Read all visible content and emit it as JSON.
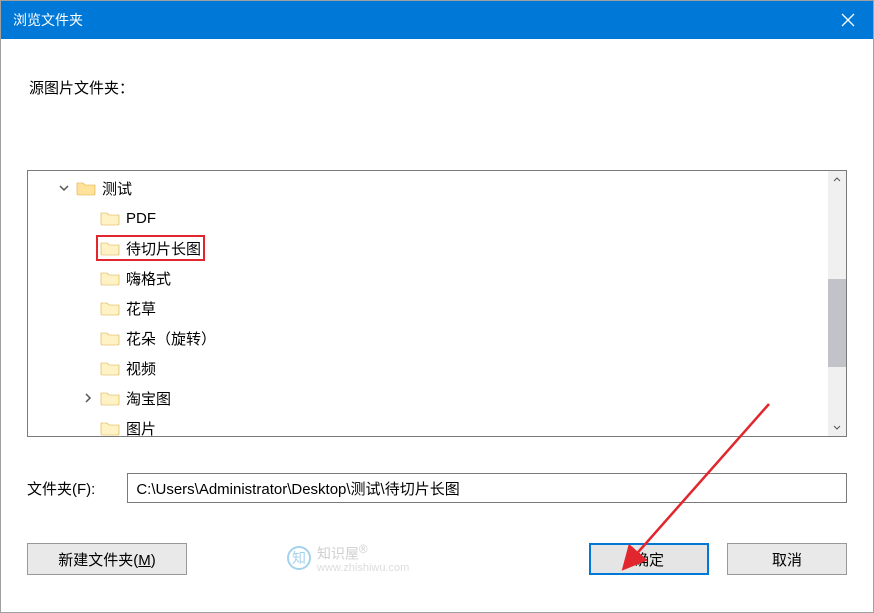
{
  "window": {
    "title": "浏览文件夹"
  },
  "labels": {
    "source_folder": "源图片文件夹：",
    "path_label": "文件夹(F):"
  },
  "tree": {
    "root": "测试",
    "items": [
      "PDF",
      "待切片长图",
      "嗨格式",
      "花草",
      "花朵（旋转）",
      "视频",
      "淘宝图",
      "图片"
    ],
    "selected": "待切片长图"
  },
  "path": {
    "value": "C:\\Users\\Administrator\\Desktop\\测试\\待切片长图"
  },
  "buttons": {
    "new_folder": "新建文件夹(M)",
    "new_folder_plain": "新建文件夹(",
    "new_folder_key": "M",
    "ok": "确定",
    "cancel": "取消"
  },
  "watermark": {
    "brand": "知识屋",
    "reg": "®",
    "url": "www.zhishiwu.com"
  },
  "colors": {
    "accent": "#0078d7",
    "annotation": "#e1262d"
  }
}
